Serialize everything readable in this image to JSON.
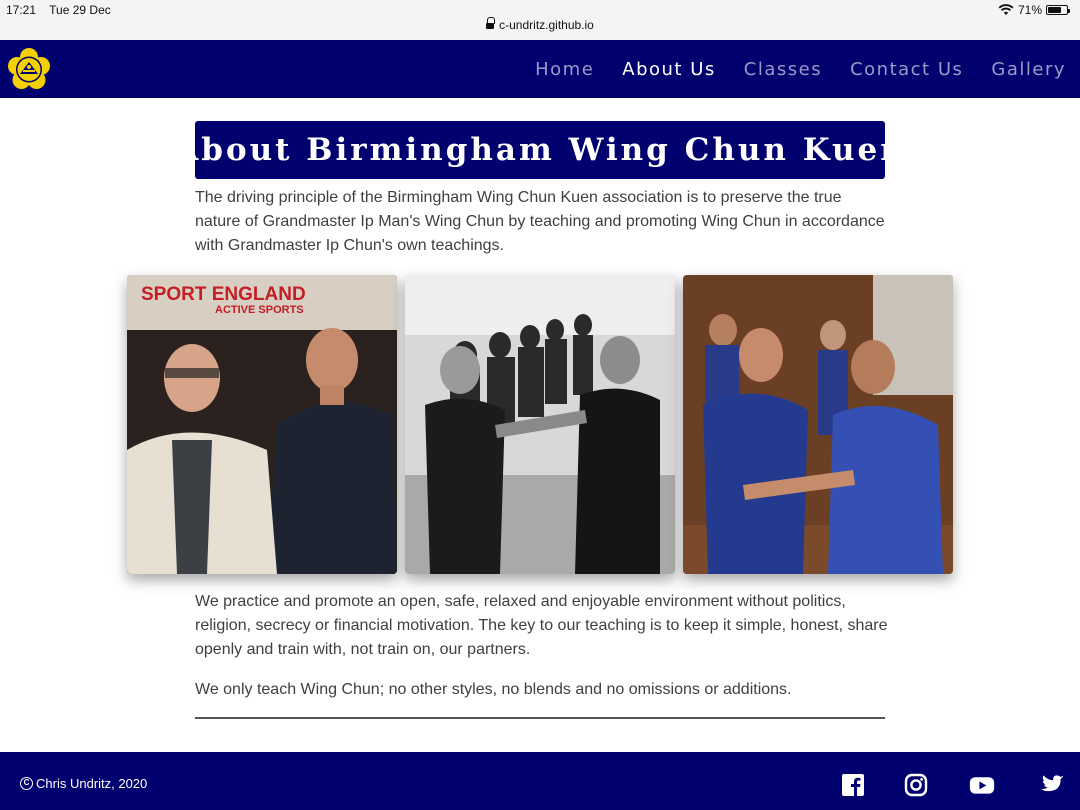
{
  "statusbar": {
    "time": "17:21",
    "date": "Tue 29 Dec",
    "url": "c-undritz.github.io",
    "battery": "71%",
    "battery_level": 0.71
  },
  "nav": {
    "items": [
      {
        "label": "Home",
        "active": false
      },
      {
        "label": "About Us",
        "active": true
      },
      {
        "label": "Classes",
        "active": false
      },
      {
        "label": "Contact Us",
        "active": false
      },
      {
        "label": "Gallery",
        "active": false
      }
    ]
  },
  "main": {
    "title": "About Birmingham Wing Chun Kuen",
    "intro": "The driving principle of the Birmingham Wing Chun Kuen association is to preserve the true nature of Grandmaster Ip Man's Wing Chun by teaching and promoting Wing Chun in accordance with Grandmaster Ip Chun's own teachings.",
    "paragraph2": "We practice and promote an open, safe, relaxed and enjoyable environment without politics, religion, secrecy or financial motivation. The key to our teaching is to keep it simple, honest, share openly and train with, not train on, our partners.",
    "paragraph3": "We only teach Wing Chun; no other styles, no blends and no omissions or additions.",
    "photo1_sign": "SPORT ENGLAND",
    "photo1_sign_sub": "ACTIVE SPORTS"
  },
  "footer": {
    "copyright": "Chris Undritz, 2020",
    "social": [
      "facebook-icon",
      "instagram-icon",
      "youtube-icon",
      "twitter-icon"
    ]
  },
  "colors": {
    "brand_navy": "#00006e",
    "nav_inactive": "#9a9ac8",
    "logo_yellow": "#f5d000"
  }
}
